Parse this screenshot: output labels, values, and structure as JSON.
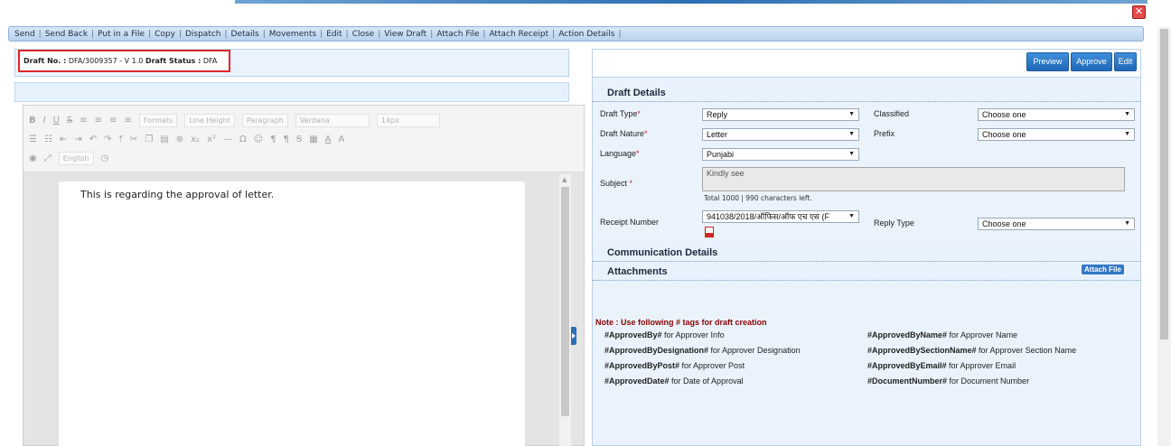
{
  "window": {
    "close_label": "✕"
  },
  "toolbar": {
    "items": [
      "Send",
      "Send Back",
      "Put in a File",
      "Copy",
      "Dispatch",
      "Details",
      "Movements",
      "Edit",
      "Close",
      "View Draft",
      "Attach File",
      "Attach Receipt",
      "Action Details"
    ]
  },
  "draft_info": {
    "number_label": "Draft No. :",
    "number_value": "DFA/3009357 - V 1.0",
    "status_label": "Draft Status :",
    "status_value": "DFA"
  },
  "editor": {
    "toolbar_row1": [
      "B",
      "I",
      "U",
      "S",
      "≡",
      "≡",
      "≡",
      "≡"
    ],
    "formats_label": "Formats",
    "line_height_label": "Line Height",
    "paragraph_label": "Paragraph",
    "font_label": "Verdana",
    "size_label": "14px",
    "language_label": "English",
    "body_text": "This is regarding the approval of letter."
  },
  "actions": {
    "preview": "Preview",
    "approve": "Approve",
    "edit": "Edit"
  },
  "draft_details": {
    "title": "Draft Details",
    "draft_type_label": "Draft Type",
    "draft_type_value": "Reply",
    "classified_label": "Classified",
    "classified_value": "Choose one",
    "draft_nature_label": "Draft Nature",
    "draft_nature_value": "Letter",
    "prefix_label": "Prefix",
    "prefix_value": "Choose one",
    "language_label": "Language",
    "language_value": "Punjabi",
    "subject_label": "Subject",
    "subject_value": "Kindly see",
    "chars_total": "Total 1000 |",
    "chars_left_count": "990",
    "chars_left_text": "characters left.",
    "receipt_label": "Receipt Number",
    "receipt_value": "941038/2018/ऑफिस/ऑफ एच एस (F",
    "reply_type_label": "Reply Type",
    "reply_type_value": "Choose one"
  },
  "communication": {
    "title": "Communication Details"
  },
  "attachments": {
    "title": "Attachments",
    "attach_button": "Attach File"
  },
  "note": {
    "title": "Note : Use following # tags for draft creation",
    "tags_left": [
      {
        "tag": "#ApprovedBy#",
        "desc": " for Approver Info"
      },
      {
        "tag": "#ApprovedByDesignation#",
        "desc": " for Approver Designation"
      },
      {
        "tag": "#ApprovedByPost#",
        "desc": " for Approver Post"
      },
      {
        "tag": "#ApprovedDate#",
        "desc": " for Date of Approval"
      }
    ],
    "tags_right": [
      {
        "tag": "#ApprovedByName#",
        "desc": " for Approver Name"
      },
      {
        "tag": "#ApprovedBySectionName#",
        "desc": " for Approver Section Name"
      },
      {
        "tag": "#ApprovedByEmail#",
        "desc": " for Approver Email"
      },
      {
        "tag": "#DocumentNumber#",
        "desc": " for Document Number"
      }
    ]
  },
  "colors": {
    "accent": "#2d6fb3",
    "danger": "#e34a4a",
    "panel": "#eaf3fc",
    "note": "#8b0000"
  }
}
